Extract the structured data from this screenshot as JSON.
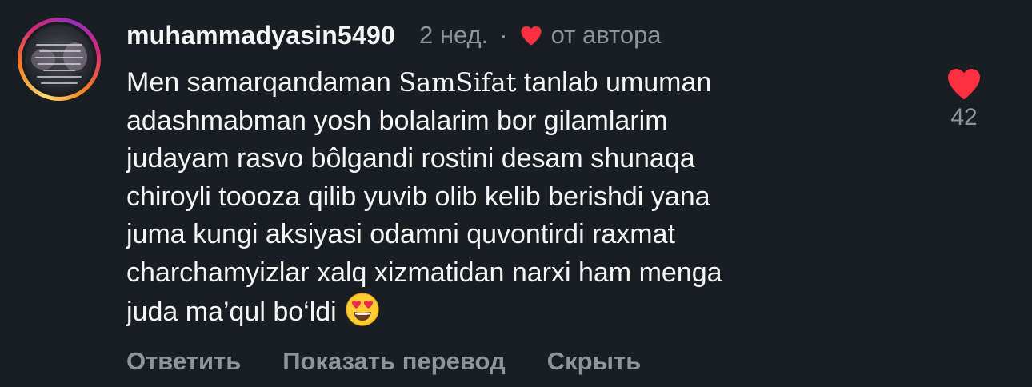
{
  "comment": {
    "username": "muhammadyasin5490",
    "time": "2 нед.",
    "separator": "·",
    "liked_by_author_label": "от автора",
    "body_lines": [
      {
        "before": "Men samarqandaman ",
        "brand": "SamSifat",
        "after": " tanlab umuman"
      },
      "adashmabman yosh bolalarim bor gilamlarim",
      "judayam rasvo bôlgandi rostini desam shunaqa",
      "chiroyli toooza qilib yuvib olib kelib berishdi yana",
      "juma kungi aksiyasi odamni quvontirdi raxmat",
      "charchamyizlar xalq xizmatidan narxi ham menga",
      "juda ma’qul bo‘ldi"
    ],
    "body_emoji": "smiling-face-with-heart-eyes",
    "like_count": "42",
    "actions": {
      "reply": "Ответить",
      "translate": "Показать перевод",
      "hide": "Скрыть"
    }
  },
  "colors": {
    "background": "#191e23",
    "text_primary": "#f5f5f5",
    "text_secondary": "#8e949b",
    "heart_red": "#ff3040"
  },
  "icons": {
    "author_like": "heart-icon",
    "like_button": "heart-icon",
    "avatar": "avatar-image"
  }
}
